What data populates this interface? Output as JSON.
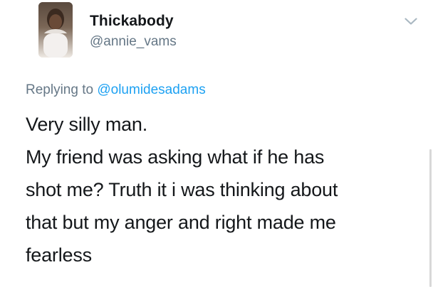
{
  "tweet": {
    "user": {
      "display_name": "Thickabody",
      "handle": "@annie_vams",
      "avatar_icon": "avatar-photo-icon"
    },
    "menu_icon": "chevron-down-icon",
    "replying_to": {
      "prefix": "Replying to ",
      "mention": "@olumidesadams"
    },
    "text": "Very silly man.\nMy friend was asking what if he has\nshot me? Truth it i was thinking about\nthat but my anger and right made me\nfearless"
  },
  "colors": {
    "text": "#14171a",
    "secondary": "#657786",
    "link": "#1da1f2"
  }
}
